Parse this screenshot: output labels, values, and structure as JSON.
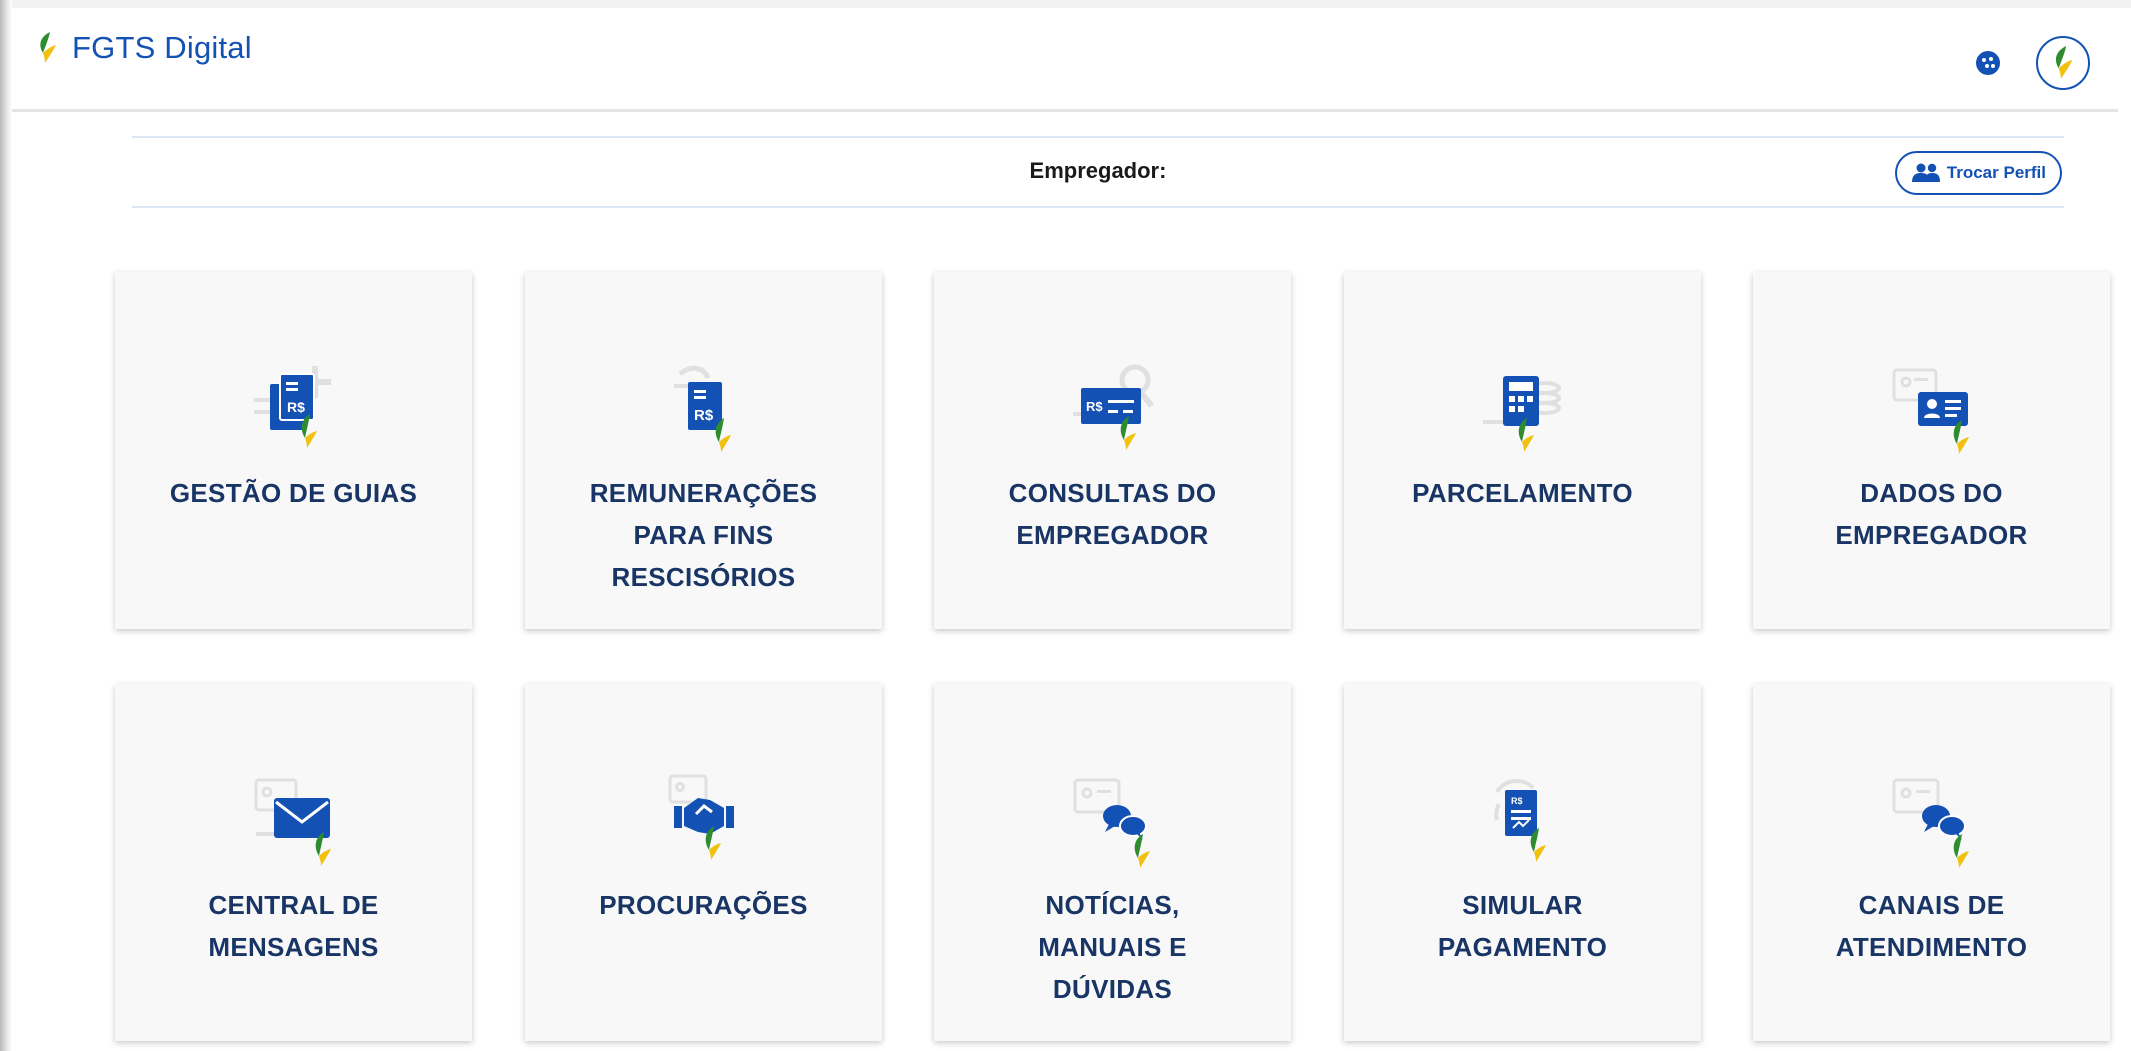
{
  "header": {
    "brand_text": "FGTS Digital",
    "cookie_icon": "cookie-icon",
    "avatar_icon": "fgts-leaf-icon"
  },
  "profile_bar": {
    "label": "Empregador:",
    "swap_button": "Trocar Perfil",
    "swap_icon": "users-icon"
  },
  "colors": {
    "brand_blue": "#1351b4",
    "card_title": "#183565",
    "card_bg": "#f8f8f8",
    "leaf_green": "#2e8b2e",
    "leaf_yellow": "#f2c10f"
  },
  "cards": [
    {
      "line1": "GESTÃO DE GUIAS",
      "line2": "",
      "line3": "",
      "icon": "guides-icon"
    },
    {
      "line1": "REMUNERAÇÕES",
      "line2": "PARA FINS",
      "line3": "RESCISÓRIOS",
      "icon": "remuneration-icon"
    },
    {
      "line1": "CONSULTAS DO",
      "line2": "EMPREGADOR",
      "line3": "",
      "icon": "search-payment-icon"
    },
    {
      "line1": "PARCELAMENTO",
      "line2": "",
      "line3": "",
      "icon": "calculator-icon"
    },
    {
      "line1": "DADOS DO",
      "line2": "EMPREGADOR",
      "line3": "",
      "icon": "id-card-icon"
    },
    {
      "line1": "CENTRAL DE",
      "line2": "MENSAGENS",
      "line3": "",
      "icon": "envelope-icon"
    },
    {
      "line1": "PROCURAÇÕES",
      "line2": "",
      "line3": "",
      "icon": "handshake-icon"
    },
    {
      "line1": "NOTÍCIAS,",
      "line2": "MANUAIS E",
      "line3": "DÚVIDAS",
      "icon": "chat-news-icon"
    },
    {
      "line1": "SIMULAR",
      "line2": "PAGAMENTO",
      "line3": "",
      "icon": "simulate-payment-icon"
    },
    {
      "line1": "CANAIS DE",
      "line2": "ATENDIMENTO",
      "line3": "",
      "icon": "chat-support-icon"
    }
  ]
}
